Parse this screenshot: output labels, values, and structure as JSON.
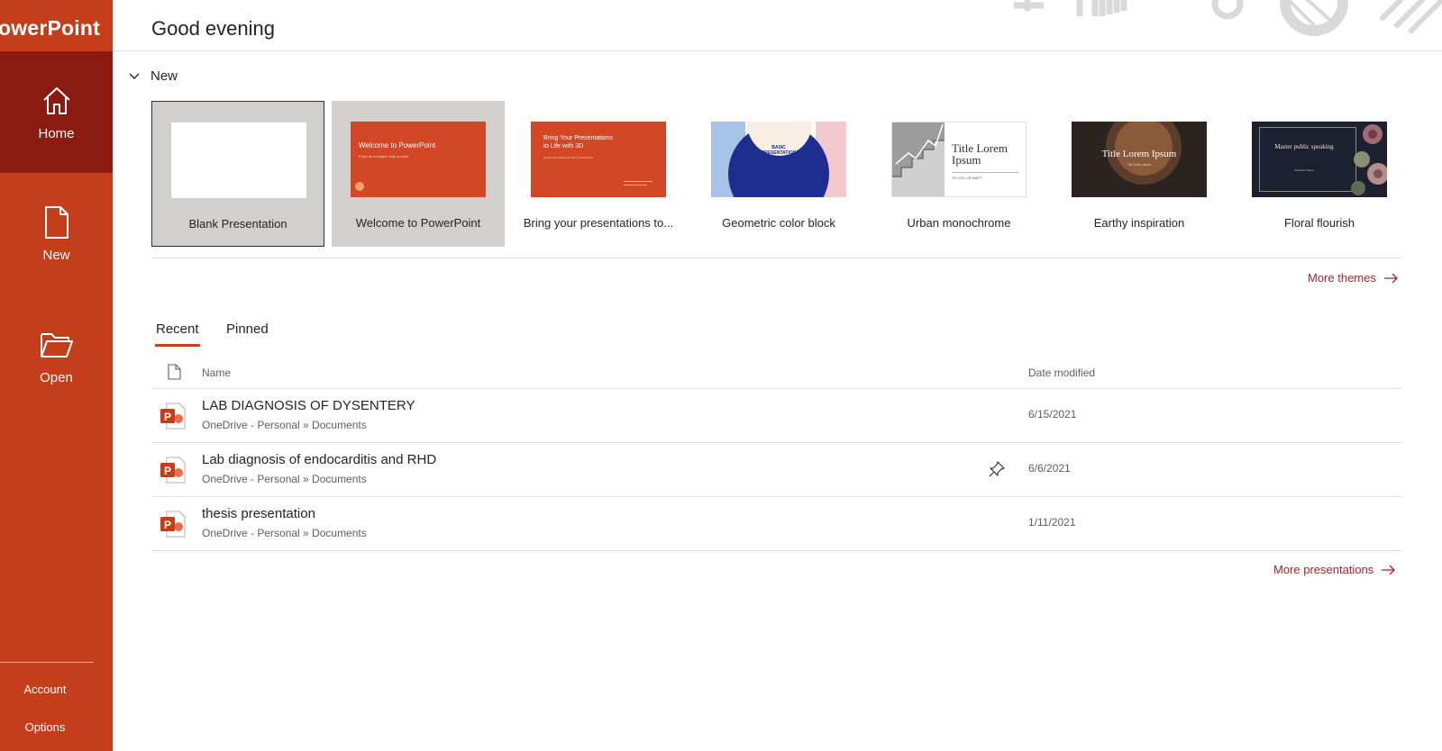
{
  "app": {
    "title": "PowerPoint"
  },
  "sidebar": {
    "items": [
      {
        "label": "Home",
        "icon": "home-icon",
        "active": true
      },
      {
        "label": "New",
        "icon": "new-document-icon",
        "active": false
      },
      {
        "label": "Open",
        "icon": "open-folder-icon",
        "active": false
      }
    ],
    "footer": [
      {
        "label": "Account"
      },
      {
        "label": "Options"
      }
    ]
  },
  "header": {
    "greeting": "Good evening"
  },
  "new_section": {
    "label": "New",
    "templates": [
      {
        "label": "Blank Presentation"
      },
      {
        "label": "Welcome to PowerPoint",
        "thumb_title": "Welcome to PowerPoint",
        "thumb_sub": "5 tips for a simpler way to work"
      },
      {
        "label": "Bring your presentations to...",
        "thumb_title": "Bring Your Presentations to Life with 3D",
        "thumb_sub": "How to get started with 3D in PowerPoint"
      },
      {
        "label": "Geometric color block",
        "thumb_title": "BASIC PRESENTATION"
      },
      {
        "label": "Urban monochrome",
        "thumb_title": "Title Lorem Ipsum",
        "thumb_sub": "SIT DOLOR AMET"
      },
      {
        "label": "Earthy inspiration",
        "thumb_title": "Title Lorem Ipsum",
        "thumb_sub": "Sit Dolor Amet"
      },
      {
        "label": "Floral flourish",
        "thumb_title": "Master public speaking",
        "thumb_sub": "Presenter Name"
      }
    ],
    "more_themes": "More themes"
  },
  "tabs": [
    {
      "label": "Recent",
      "active": true
    },
    {
      "label": "Pinned",
      "active": false
    }
  ],
  "table": {
    "headers": {
      "name": "Name",
      "date": "Date modified"
    },
    "rows": [
      {
        "name": "LAB DIAGNOSIS OF DYSENTERY",
        "path": "OneDrive - Personal » Documents",
        "date": "6/15/2021",
        "pinned": false
      },
      {
        "name": "Lab diagnosis of endocarditis and RHD",
        "path": "OneDrive - Personal » Documents",
        "date": "6/6/2021",
        "pinned": true
      },
      {
        "name": "thesis presentation",
        "path": "OneDrive - Personal » Documents",
        "date": "1/11/2021",
        "pinned": false
      }
    ],
    "more_presentations": "More presentations"
  },
  "colors": {
    "brand": "#c43e1c",
    "brand_dark": "#8b1a10",
    "link": "#a4262c"
  }
}
